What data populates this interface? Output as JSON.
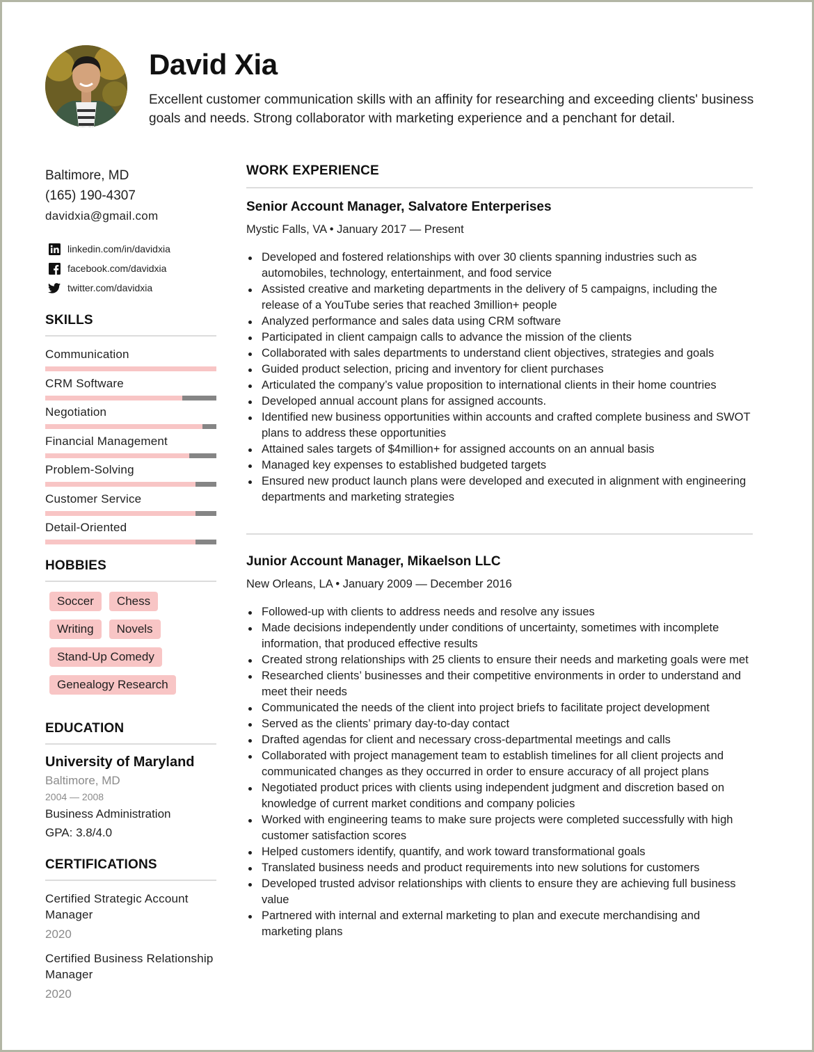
{
  "header": {
    "name": "David Xia",
    "summary": "Excellent customer communication skills with an affinity for researching and exceeding clients' business goals and needs. Strong collaborator with marketing experience and a penchant for detail."
  },
  "contact": {
    "location": "Baltimore, MD",
    "phone": "(165) 190-4307",
    "email": "davidxia@gmail.com",
    "socials": [
      {
        "icon": "linkedin-icon",
        "label": "linkedin.com/in/davidxia"
      },
      {
        "icon": "facebook-icon",
        "label": "facebook.com/davidxia"
      },
      {
        "icon": "twitter-icon",
        "label": "twitter.com/davidxia"
      }
    ]
  },
  "colors": {
    "skill_fill": "#f8c5c5",
    "skill_track": "#858585",
    "tag_bg": "#f8c5c5",
    "divider": "#dcdcdc"
  },
  "skills": {
    "title": "SKILLS",
    "items": [
      {
        "label": "Communication",
        "level": 1.0
      },
      {
        "label": "CRM Software",
        "level": 0.8
      },
      {
        "label": "Negotiation",
        "level": 0.92
      },
      {
        "label": "Financial Management",
        "level": 0.84
      },
      {
        "label": "Problem-Solving",
        "level": 0.88
      },
      {
        "label": "Customer Service",
        "level": 0.88
      },
      {
        "label": "Detail-Oriented",
        "level": 0.88
      }
    ]
  },
  "hobbies": {
    "title": "HOBBIES",
    "items": [
      "Soccer",
      "Chess",
      "Writing",
      "Novels",
      "Stand-Up Comedy",
      "Genealogy Research"
    ]
  },
  "education": {
    "title": "EDUCATION",
    "school": "University of Maryland",
    "location": "Baltimore, MD",
    "years": "2004 — 2008",
    "degree": "Business Administration",
    "gpa": "GPA: 3.8/4.0"
  },
  "certifications": {
    "title": "CERTIFICATIONS",
    "items": [
      {
        "name": "Certified Strategic Account Manager",
        "year": "2020"
      },
      {
        "name": "Certified Business Relationship Manager",
        "year": "2020"
      }
    ]
  },
  "experience": {
    "title": "WORK EXPERIENCE",
    "jobs": [
      {
        "title": "Senior Account Manager, Salvatore Enterperises",
        "meta": "Mystic Falls, VA • January 2017 — Present",
        "bullets": [
          "Developed and fostered relationships with over 30 clients spanning industries such as automobiles, technology, entertainment, and food service",
          "Assisted creative and marketing departments in the delivery of 5 campaigns, including the release of a YouTube series that reached 3million+ people",
          "Analyzed performance and sales data using CRM software",
          "Participated in client campaign calls to advance the mission of the clients",
          "Collaborated with sales departments to understand client objectives, strategies and goals",
          "Guided product selection, pricing and inventory for client purchases",
          "Articulated the company’s value proposition to international clients in their home countries",
          "Developed annual account plans for assigned accounts.",
          "Identified new business opportunities within accounts and crafted complete business and SWOT plans to address these opportunities",
          "Attained sales targets of $4million+ for assigned accounts on an annual basis",
          "Managed key expenses to established budgeted targets",
          "Ensured new product launch plans were developed and executed in alignment with engineering departments and marketing strategies"
        ]
      },
      {
        "title": "Junior Account Manager, Mikaelson LLC",
        "meta": "New Orleans, LA • January 2009 — December 2016",
        "bullets": [
          "Followed-up with clients to address needs and resolve any issues",
          "Made decisions independently under conditions of uncertainty, sometimes with incomplete information, that produced effective results",
          "Created strong relationships with 25 clients to ensure their needs and marketing goals were met",
          "Researched clients’ businesses and their competitive environments in order to understand and meet their needs",
          "Communicated the needs of the client into project briefs to facilitate project development",
          "Served as the clients’ primary day-to-day contact",
          "Drafted agendas for client and necessary cross-departmental meetings and calls",
          "Collaborated with project management team to establish timelines for all client projects and communicated changes as they occurred in order to ensure accuracy of all project plans",
          "Negotiated product prices with clients using independent judgment and discretion based on knowledge of current market conditions and company policies",
          "Worked with engineering teams to make sure projects were completed successfully with high customer satisfaction scores",
          "Helped customers identify, quantify, and work toward transformational goals",
          "Translated business needs and product requirements into new solutions for customers",
          "Developed trusted advisor relationships with clients to ensure they are achieving full business value",
          "Partnered with internal and external marketing to plan and execute merchandising and marketing plans"
        ]
      }
    ]
  }
}
